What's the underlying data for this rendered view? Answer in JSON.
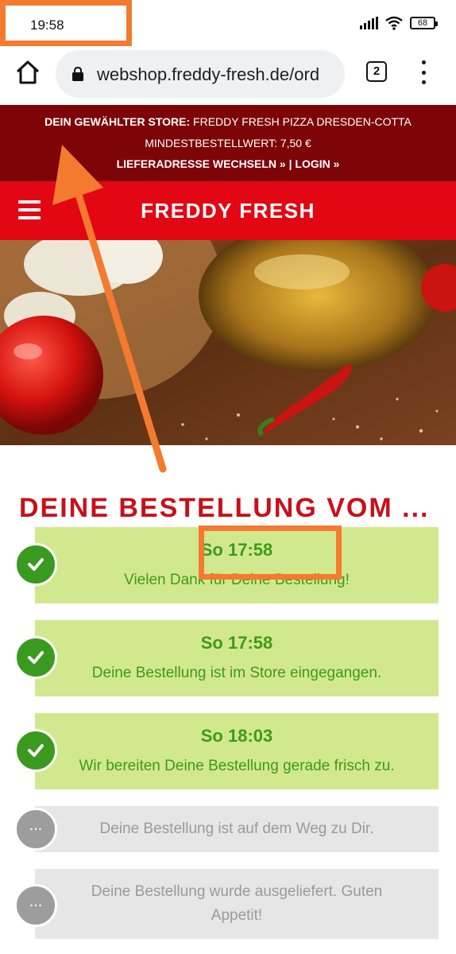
{
  "statusbar": {
    "time": "19:58",
    "battery": "68"
  },
  "browser": {
    "url": "webshop.freddy-fresh.de/ord",
    "tab_count": "2"
  },
  "store": {
    "label": "DEIN GEWÄHLTER STORE:",
    "name": "FREDDY FRESH PIZZA DRESDEN-COTTA",
    "min_order": "MINDESTBESTELLWERT: 7,50 €",
    "change_address": "LIEFERADRESSE WECHSELN »",
    "separator": "|",
    "login": "LOGIN »"
  },
  "header": {
    "brand": "FREDDY FRESH"
  },
  "order": {
    "heading": "DEINE BESTELLUNG VOM ...",
    "steps": [
      {
        "time": "So 17:58",
        "text": "Vielen Dank für Deine Bestellung!",
        "status": "done"
      },
      {
        "time": "So 17:58",
        "text": "Deine Bestellung ist im Store eingegangen.",
        "status": "done"
      },
      {
        "time": "So 18:03",
        "text": "Wir bereiten Deine Bestellung gerade frisch zu.",
        "status": "done"
      },
      {
        "text": "Deine Bestellung ist auf dem Weg zu Dir.",
        "status": "pending",
        "marker": "..."
      },
      {
        "text": "Deine Bestellung wurde ausgeliefert. Guten Appetit!",
        "status": "pending",
        "marker": "..."
      }
    ]
  },
  "colors": {
    "store_bar": "#7d0508",
    "header": "#e30613",
    "heading": "#c8101a",
    "step_done_bg": "#d2e88f",
    "step_done_text": "#3f9a1b",
    "step_pending_bg": "#e6e6e6",
    "annotation": "#f47a2f"
  }
}
